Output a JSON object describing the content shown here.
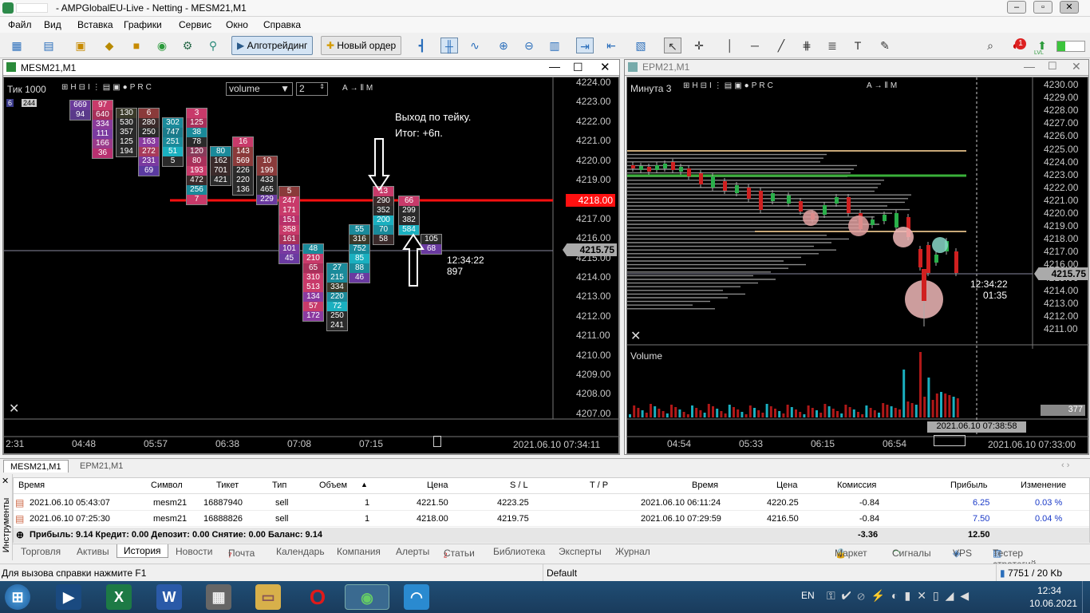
{
  "window": {
    "title": "- AMPGlobalEU-Live - Netting - MESM21,M1"
  },
  "menu": [
    "Файл",
    "Вид",
    "Вставка",
    "Графики",
    "Сервис",
    "Окно",
    "Справка"
  ],
  "toolbar": {
    "algo_label": "Алготрейдинг",
    "new_order_label": "Новый ордер",
    "notif_count": "1",
    "lvl": "LVL"
  },
  "chart1": {
    "title": "MESM21,M1",
    "tick_label": "Тик",
    "tick_value": "1000",
    "mode_select": "volume",
    "mode_num": "2",
    "small_left": "6",
    "small_left2": "244",
    "annotation_line1": "Выход по тейку.",
    "annotation_line2": "Итог: +6п.",
    "time_stamp": "12:34:22",
    "time_stamp2": "897",
    "price_red": "4218.00",
    "price_grey": "4215.75",
    "price_ticks": [
      "4224.00",
      "4223.00",
      "4222.00",
      "4221.00",
      "4220.00",
      "4219.00",
      "4218.00",
      "4217.00",
      "4216.00",
      "4215.00",
      "4214.00",
      "4213.00",
      "4212.00",
      "4211.00",
      "4210.00",
      "4209.00",
      "4208.00",
      "4207.00"
    ],
    "time_ticks": [
      "2:31",
      "04:48",
      "05:57",
      "06:38",
      "07:08",
      "07:15"
    ],
    "date_time": "2021.06.10 07:34:11"
  },
  "chart2": {
    "title": "EPM21,M1",
    "tf_label": "Минута",
    "tf_value": "3",
    "price_grey": "4215.75",
    "time_stamp": "12:34:22",
    "time_stamp2": "01:35",
    "volume_label": "Volume",
    "volume_value": "377",
    "crosshair_date": "2021.06.10 07:38:58",
    "price_ticks": [
      "4230.00",
      "4229.00",
      "4228.00",
      "4227.00",
      "4226.00",
      "4225.00",
      "4224.00",
      "4223.00",
      "4222.00",
      "4221.00",
      "4220.00",
      "4219.00",
      "4218.00",
      "4217.00",
      "4216.00",
      "4215.00",
      "4214.00",
      "4213.00",
      "4212.00",
      "4211.00"
    ],
    "time_ticks": [
      "04:54",
      "05:33",
      "06:15",
      "06:54"
    ],
    "date_time": "2021.06.10 07:33:00"
  },
  "chart_tabs": [
    "MESM21,M1",
    "EPM21,M1"
  ],
  "history": {
    "headers": [
      "Время",
      "Символ",
      "Тикет",
      "Тип",
      "Объем",
      "Цена",
      "S / L",
      "T / P",
      "Время",
      "Цена",
      "Комиссия",
      "Прибыль",
      "Изменение"
    ],
    "rows": [
      [
        "2021.06.10 05:43:07",
        "mesm21",
        "16887940",
        "sell",
        "1",
        "4221.50",
        "4223.25",
        "",
        "2021.06.10 06:11:24",
        "4220.25",
        "-0.84",
        "6.25",
        "0.03 %"
      ],
      [
        "2021.06.10 07:25:30",
        "mesm21",
        "16888826",
        "sell",
        "1",
        "4218.00",
        "4219.75",
        "",
        "2021.06.10 07:29:59",
        "4216.50",
        "-0.84",
        "7.50",
        "0.04 %"
      ]
    ],
    "summary": "Прибыль: 9.14  Кредит: 0.00  Депозит: 0.00  Снятие: 0.00  Баланс: 9.14",
    "summary_commission": "-3.36",
    "summary_profit": "12.50",
    "side_label": "Инструменты"
  },
  "bottom_tabs": [
    "Торговля",
    "Активы",
    "История",
    "Новости",
    "Почта",
    "Календарь",
    "Компания",
    "Алерты",
    "Статьи",
    "Библиотека",
    "Эксперты",
    "Журнал"
  ],
  "mail_badge": "7",
  "articles_badge": "2",
  "right_links": [
    "Маркет",
    "Сигналы",
    "VPS",
    "Тестер стратегий"
  ],
  "status": {
    "help": "Для вызова справки нажмите F1",
    "profile": "Default",
    "traffic": "7751 / 20 Kb"
  },
  "taskbar": {
    "lang": "EN",
    "time": "12:34",
    "date": "10.06.2021"
  }
}
